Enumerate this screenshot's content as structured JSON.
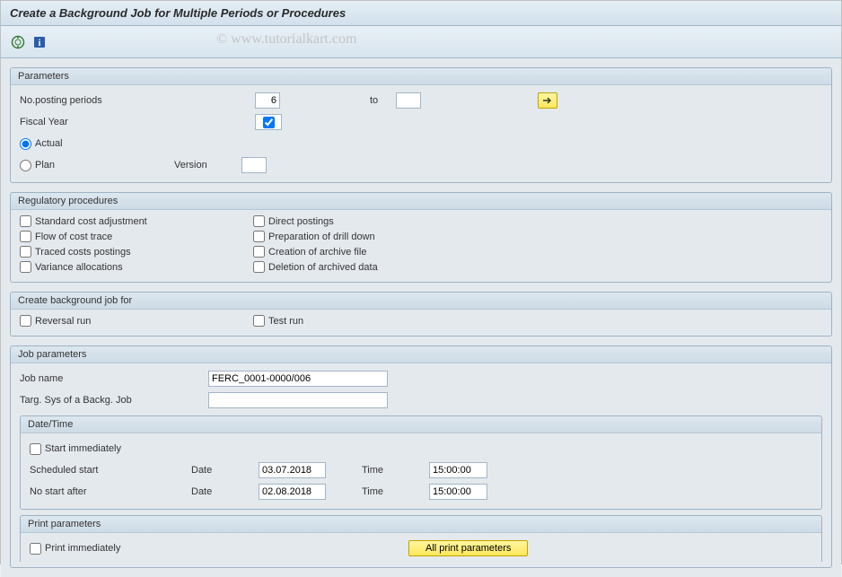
{
  "header": {
    "title": "Create a Background Job for Multiple Periods or Procedures"
  },
  "watermark": "© www.tutorialkart.com",
  "parameters": {
    "legend": "Parameters",
    "no_posting_periods_label": "No.posting periods",
    "no_posting_periods_from": "6",
    "to_label": "to",
    "no_posting_periods_to": "",
    "fiscal_year_label": "Fiscal Year",
    "actual_label": "Actual",
    "plan_label": "Plan",
    "version_label": "Version",
    "version_value": ""
  },
  "regulatory": {
    "legend": "Regulatory procedures",
    "standard_cost_adjustment": "Standard cost adjustment",
    "flow_of_cost_trace": "Flow of cost trace",
    "traced_costs_postings": "Traced costs postings",
    "variance_allocations": "Variance allocations",
    "direct_postings": "Direct postings",
    "preparation_drill_down": "Preparation of drill down",
    "creation_archive_file": "Creation of archive file",
    "deletion_archived_data": "Deletion of archived data"
  },
  "create_bg_job": {
    "legend": "Create background job for",
    "reversal_run": "Reversal run",
    "test_run": "Test run"
  },
  "job_params": {
    "legend": "Job parameters",
    "job_name_label": "Job name",
    "job_name_value": "FERC_0001-0000/006",
    "targ_sys_label": "Targ. Sys of a Backg. Job",
    "targ_sys_value": "",
    "datetime": {
      "legend": "Date/Time",
      "start_immediately": "Start immediately",
      "scheduled_start_label": "Scheduled start",
      "date_label": "Date",
      "time_label": "Time",
      "scheduled_date": "03.07.2018",
      "scheduled_time": "15:00:00",
      "no_start_after_label": "No start after",
      "no_start_after_date": "02.08.2018",
      "no_start_after_time": "15:00:00"
    },
    "print": {
      "legend": "Print parameters",
      "print_immediately": "Print immediately",
      "all_print_button": "All print parameters"
    }
  }
}
